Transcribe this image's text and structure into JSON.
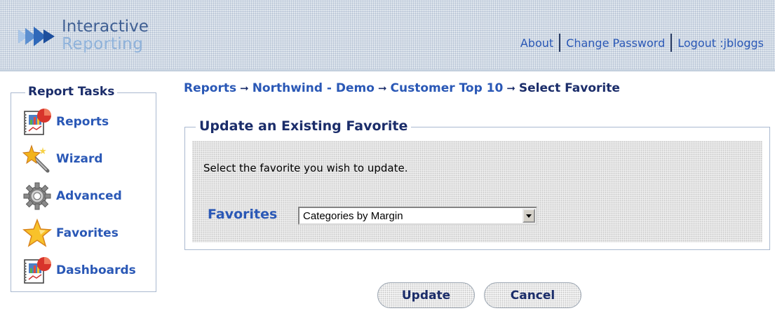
{
  "header": {
    "logo": {
      "line1": "Interactive",
      "line2": "Reporting"
    },
    "links": {
      "about": "About",
      "change_password": "Change Password",
      "logout": "Logout :jbloggs"
    }
  },
  "sidebar": {
    "title": "Report Tasks",
    "items": [
      {
        "label": "Reports",
        "icon": "reports-icon"
      },
      {
        "label": "Wizard",
        "icon": "wizard-icon"
      },
      {
        "label": "Advanced",
        "icon": "gear-icon"
      },
      {
        "label": "Favorites",
        "icon": "star-icon"
      },
      {
        "label": "Dashboards",
        "icon": "dashboard-icon"
      }
    ]
  },
  "breadcrumb": {
    "items": [
      "Reports",
      "Northwind - Demo",
      "Customer Top 10"
    ],
    "current": "Select Favorite",
    "separator": "➞"
  },
  "form": {
    "title": "Update an Existing Favorite",
    "instruction": "Select the favorite you wish to update.",
    "favorites_label": "Favorites",
    "favorites_selected": "Categories by Margin"
  },
  "buttons": {
    "update": "Update",
    "cancel": "Cancel"
  },
  "colors": {
    "link": "#2a58b6",
    "heading": "#1b2d6a",
    "border": "#aab9d0"
  }
}
